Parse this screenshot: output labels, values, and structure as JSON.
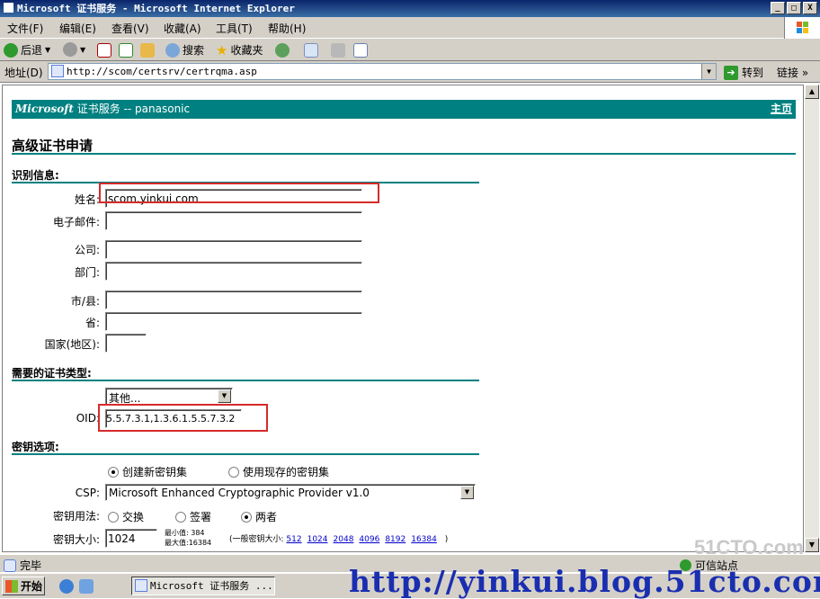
{
  "window": {
    "title": "Microsoft 证书服务 - Microsoft Internet Explorer",
    "btn_min": "_",
    "btn_max": "□",
    "btn_close": "X"
  },
  "menu": [
    "文件(F)",
    "编辑(E)",
    "查看(V)",
    "收藏(A)",
    "工具(T)",
    "帮助(H)"
  ],
  "toolbar": {
    "back": "后退",
    "search": "搜索",
    "favorites": "收藏夹"
  },
  "address": {
    "label": "地址(D)",
    "url": "http://scom/certsrv/certrqma.asp",
    "go": "转到",
    "links": "链接 »"
  },
  "page": {
    "brand": "Microsoft",
    "service": " 证书服务 --  panasonic",
    "home": "主页",
    "heading": "高级证书申请",
    "ident_section": "识别信息:",
    "fields": {
      "name_label": "姓名:",
      "name_value": "scom.yinkui.com",
      "email_label": "电子邮件:",
      "email_value": "",
      "company_label": "公司:",
      "company_value": "",
      "dept_label": "部门:",
      "dept_value": "",
      "city_label": "市/县:",
      "city_value": "",
      "state_label": "省:",
      "state_value": "",
      "country_label": "国家(地区):",
      "country_value": ""
    },
    "cert_section": "需要的证书类型:",
    "cert_type": "其他...",
    "oid_label": "OID:",
    "oid_value": "5.5.7.3.1,1.3.6.1.5.5.7.3.2",
    "key_section": "密钥选项:",
    "radio_new": "创建新密钥集",
    "radio_existing": "使用现存的密钥集",
    "csp_label": "CSP:",
    "csp_value": "Microsoft Enhanced Cryptographic Provider v1.0",
    "usage_label": "密钥用法:",
    "usage_exchange": "交换",
    "usage_sign": "签署",
    "usage_both": "两者",
    "keysize_label": "密钥大小:",
    "keysize_value": "1024",
    "min_text": "最小值:  384",
    "max_text": "最大值:16384",
    "common_text": "(一般密钥大小:",
    "common_sizes": [
      "512",
      "1024",
      "2048",
      "4096",
      "8192",
      "16384"
    ],
    "common_close": ")"
  },
  "status": {
    "done": "完毕",
    "zone": "可信站点"
  },
  "taskbar": {
    "start": "开始",
    "task": "Microsoft 证书服务 ..."
  },
  "watermark": {
    "url": "http://yinkui.blog.51cto.com/",
    "site": "51CTO.com"
  },
  "colors": {
    "teal": "#008080",
    "highlight": "#d62b2b",
    "title": "#0a246a"
  }
}
